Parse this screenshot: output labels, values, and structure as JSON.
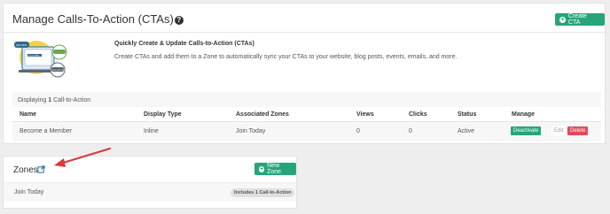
{
  "header": {
    "title": "Manage Calls-To-Action (CTAs)",
    "help_icon": "?",
    "create_button": "Create CTA"
  },
  "promo": {
    "title": "Quickly Create & Update Calls-to-Action (CTAs)",
    "text": "Create CTAs and add them to a Zone to automatically sync your CTAs to your website, blog posts, events, emails, and more.",
    "illustration_texts": [
      "GET INFO",
      "CLICK HERE",
      "FOLLOW US"
    ]
  },
  "table": {
    "displaying_prefix": "Displaying ",
    "displaying_count": "1",
    "displaying_suffix": " Call-to-Action",
    "columns": [
      "Name",
      "Display Type",
      "Associated Zones",
      "Views",
      "Clicks",
      "Status",
      "Manage"
    ],
    "rows": [
      {
        "name": "Become a Member",
        "display_type": "Inline",
        "zones": "Join Today",
        "views": "0",
        "clicks": "0",
        "status": "Active"
      }
    ],
    "actions": {
      "deactivate": "Deactivate",
      "edit": "Edit",
      "delete": "Delete"
    }
  },
  "zones": {
    "title": "Zones",
    "new_zone_button": "New Zone",
    "items": [
      {
        "name": "Join Today",
        "badge": "Includes 1 Call-to-Action"
      }
    ]
  },
  "colors": {
    "primary_green": "#26a57a",
    "danger": "#e04b59",
    "annotation_arrow": "#d9393e"
  }
}
